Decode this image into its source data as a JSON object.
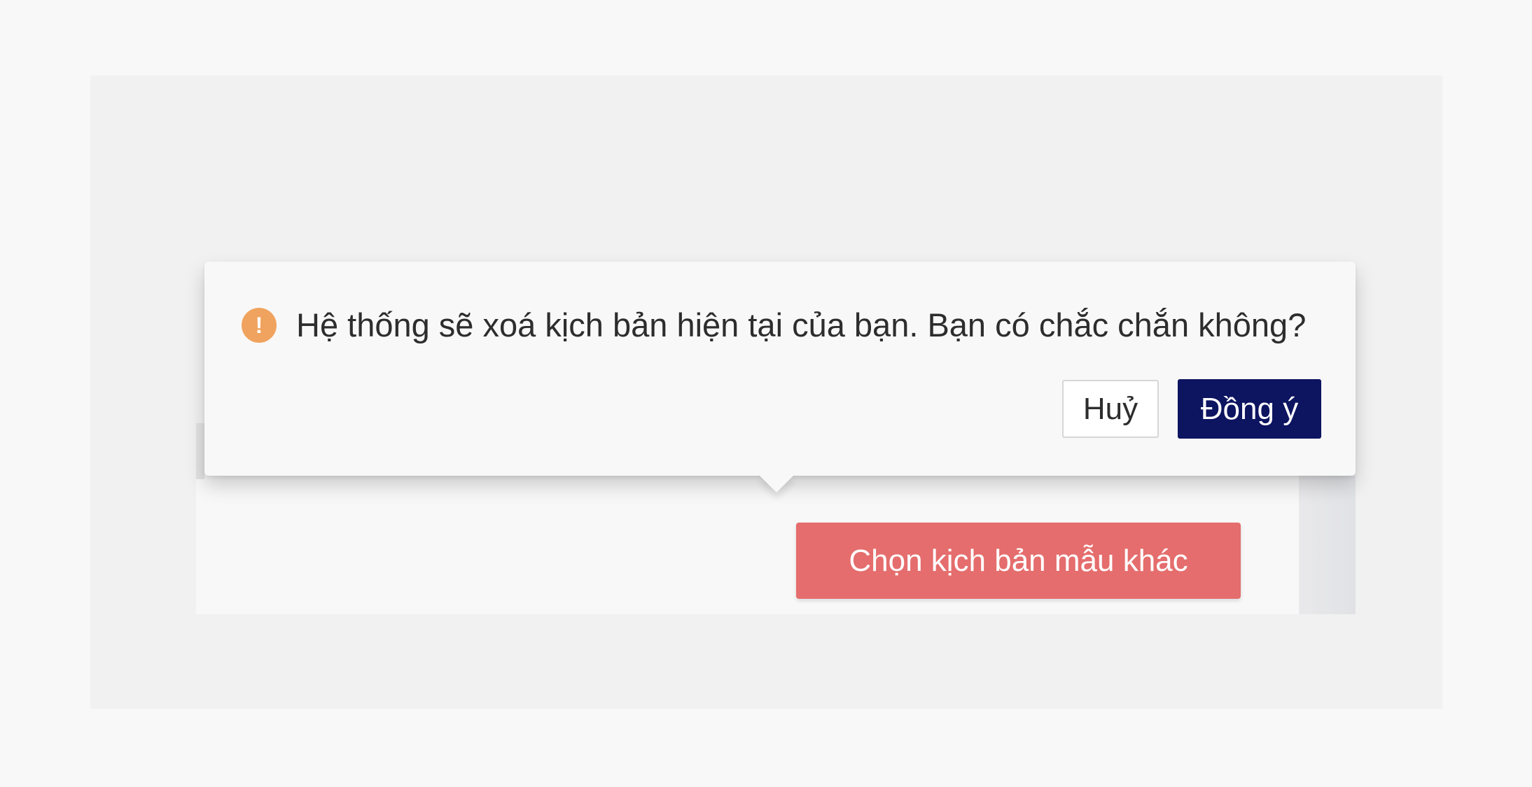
{
  "confirm": {
    "message": "Hệ thống sẽ xoá kịch bản hiện tại của bạn. Bạn có chắc chắn không?",
    "icon": "exclamation-circle-icon",
    "icon_glyph": "!",
    "cancel_label": "Huỷ",
    "ok_label": "Đồng ý"
  },
  "panel": {
    "primary_button_label": "Chọn kịch bản mẫu khác"
  },
  "colors": {
    "warning": "#f0a35e",
    "primary_dark": "#0d1460",
    "danger": "#e56d6d"
  }
}
